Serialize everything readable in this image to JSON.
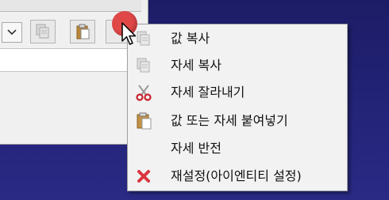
{
  "context_menu": {
    "items": [
      {
        "label": "값 복사",
        "icon": "copy-icon"
      },
      {
        "label": "자세 복사",
        "icon": "copy-icon"
      },
      {
        "label": "자세 잘라내기",
        "icon": "scissors-icon"
      },
      {
        "label": "값 또는 자세 붙여넣기",
        "icon": "paste-icon"
      },
      {
        "label": "자세 반전",
        "icon": ""
      },
      {
        "label": "재설정(아이엔티티 설정)",
        "icon": "reset-x-icon"
      }
    ]
  },
  "colors": {
    "desktop": "#1f1f6b",
    "menu_background": "#f2f2f2",
    "reset_icon": "#d9363e",
    "scissors": "#c8202a",
    "pointer_dot": "#e04848"
  }
}
